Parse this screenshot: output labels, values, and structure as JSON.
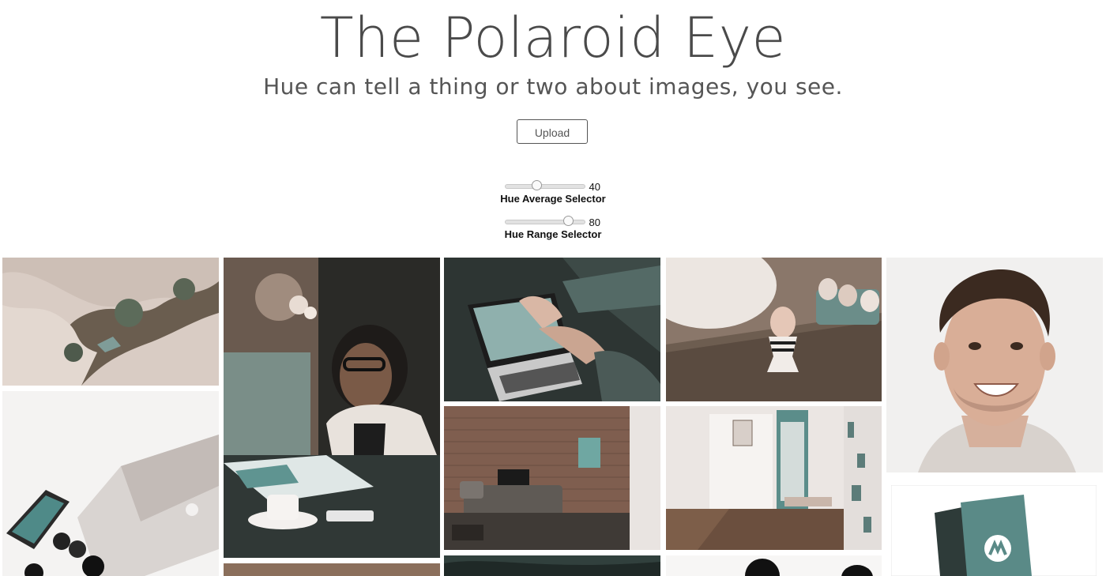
{
  "header": {
    "title": "The Polaroid Eye",
    "subtitle": "Hue can tell a thing or two about images, you see."
  },
  "upload": {
    "label": "Upload"
  },
  "sliders": [
    {
      "label": "Hue Average Selector",
      "value": "40",
      "fraction": 0.4
    },
    {
      "label": "Hue Range Selector",
      "value": "80",
      "fraction": 0.8
    }
  ],
  "gallery": {
    "photos": [
      "aerial-wetland-photo",
      "woman-reading-photo",
      "laptop-typing-photo",
      "egg-cup-photo",
      "smiling-man-portrait-photo",
      "laptop-phone-desk-photo",
      "brick-living-room-photo",
      "hallway-interior-photo",
      "business-cards-photo"
    ]
  },
  "colors": {
    "accent_teal": "#4f8a88",
    "title_gray": "#4a4a4a"
  }
}
